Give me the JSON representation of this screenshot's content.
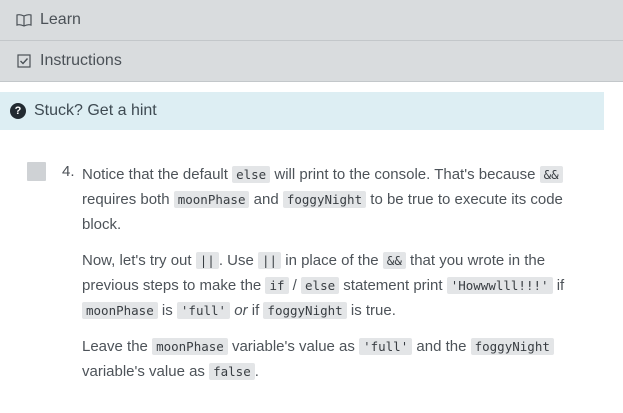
{
  "tabs": {
    "learn_label": "Learn",
    "instructions_label": "Instructions"
  },
  "hint": {
    "label": "Stuck? Get a hint"
  },
  "step": {
    "number": "4.",
    "p1": {
      "t1": "Notice that the default ",
      "c1": "else",
      "t2": " will print to the console. That's because ",
      "c2": "&&",
      "t3": " requires both ",
      "c3": "moonPhase",
      "t4": " and ",
      "c4": "foggyNight",
      "t5": " to be true to execute its code block."
    },
    "p2": {
      "t1": "Now, let's try out ",
      "c1": "||",
      "t2": ". Use ",
      "c2": "||",
      "t3": " in place of the ",
      "c3": "&&",
      "t4": " that you wrote in the previous steps to make the ",
      "c4": "if",
      "t5": " / ",
      "c5": "else",
      "t6": " statement print ",
      "c6": "'Howwwlll!!!'",
      "t7": " if ",
      "c7": "moonPhase",
      "t8": " is ",
      "c8": "'full'",
      "em1": "or",
      "t9": " if ",
      "c9": "foggyNight",
      "t10": " is true."
    },
    "p3": {
      "t1": "Leave the ",
      "c1": "moonPhase",
      "t2": " variable's value as ",
      "c2": "'full'",
      "t3": " and the ",
      "c3": "foggyNight",
      "t4": " variable's value as ",
      "c4": "false",
      "t5": "."
    }
  }
}
